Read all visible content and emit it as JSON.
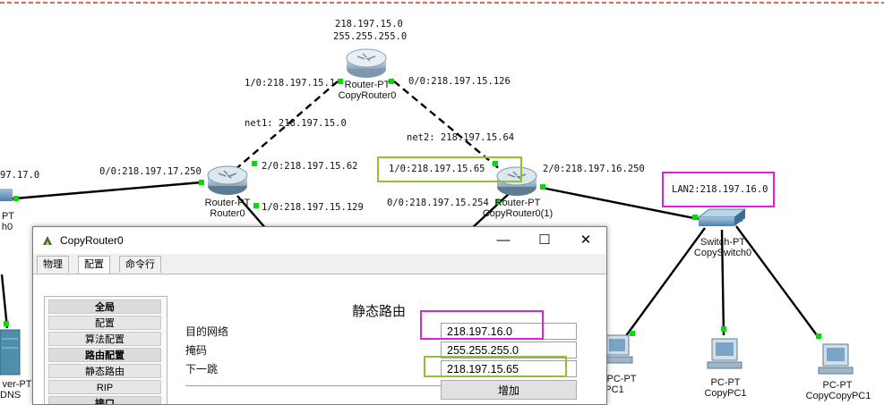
{
  "topology": {
    "networks": {
      "top": {
        "address": "218.197.15.0",
        "mask": "255.255.255.0"
      },
      "net1": "net1: 218.197.15.0",
      "net2": "net2: 218.197.15.64",
      "lan2": "LAN2:218.197.16.0",
      "left_partial": "97.17.0"
    },
    "links": {
      "cr0_if1": "1/0:218.197.15.1",
      "cr0_if0": "0/0:218.197.15.126",
      "r0_if2": "2/0:218.197.15.62",
      "r0_if0": "0/0:218.197.17.250",
      "r0_if1": "1/0:218.197.15.129",
      "cr01_if1": "1/0:218.197.15.65",
      "cr01_if2": "2/0:218.197.16.250",
      "cr01_if0": "0/0:218.197.15.254"
    },
    "devices": {
      "copyrouter0": {
        "type": "Router-PT",
        "name": "CopyRouter0"
      },
      "router0": {
        "type": "Router-PT",
        "name": "Router0"
      },
      "copyrouter0_1": {
        "type": "Router-PT",
        "name": "CopyRouter0(1)"
      },
      "copyswitch0": {
        "type": "Switch-PT",
        "name": "CopySwitch0"
      },
      "left_switch_partial": {
        "type": "PT",
        "name": "h0"
      },
      "server_partial": {
        "type": "ver-PT",
        "name": "DNS"
      },
      "pc_partial": {
        "type": "PC-PT",
        "name": "PC1"
      },
      "copypc1": {
        "type": "PC-PT",
        "name": "CopyPC1"
      },
      "copycopypc1": {
        "type": "PC-PT",
        "name": "CopyCopyPC1"
      }
    }
  },
  "colors": {
    "highlight_green": "#92c12f",
    "highlight_magenta": "#e11fd6",
    "link_up": "#00dd00",
    "topbar_red": "#c0392b"
  },
  "dialog": {
    "title": "CopyRouter0",
    "window_buttons": {
      "minimize": "—",
      "maximize": "☐",
      "close": "✕"
    },
    "tabs": [
      "物理",
      "配置",
      "命令行"
    ],
    "active_tab": "配置",
    "sidebar": {
      "items": [
        "全局",
        "配置",
        "算法配置",
        "路由配置",
        "静态路由",
        "RIP",
        "接口"
      ]
    },
    "static_route": {
      "title": "静态路由",
      "network_label": "目的网络",
      "network_value": "218.197.16.0",
      "mask_label": "掩码",
      "mask_value": "255.255.255.0",
      "nexthop_label": "下一跳",
      "nexthop_value": "218.197.15.65",
      "add_label": "增加"
    }
  }
}
